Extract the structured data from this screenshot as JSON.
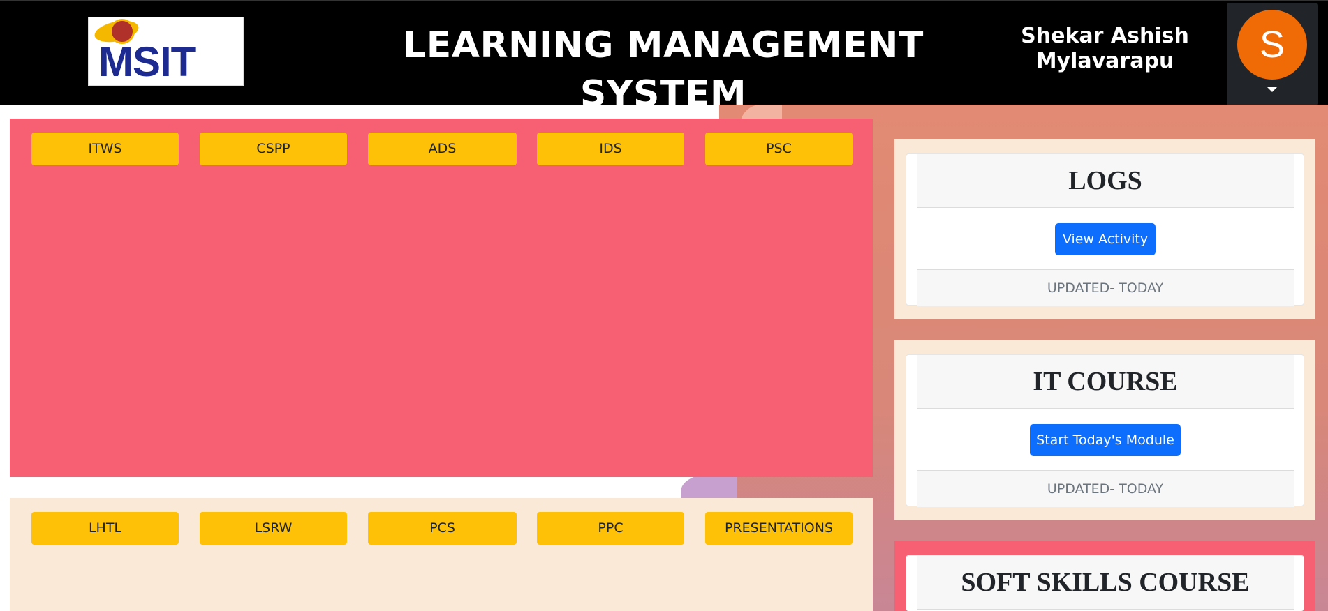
{
  "header": {
    "logo_text": "MSIT",
    "title": "LEARNING MANAGEMENT SYSTEM",
    "user_name": "Shekar Ashish Mylavarapu",
    "avatar_initial": "S"
  },
  "course_tabs_top": [
    "ITWS",
    "CSPP",
    "ADS",
    "IDS",
    "PSC"
  ],
  "course_tabs_bottom": [
    "LHTL",
    "LSRW",
    "PCS",
    "PPC",
    "PRESENTATIONS"
  ],
  "cards": {
    "logs": {
      "title": "LOGS",
      "button": "View Activity",
      "footer": "UPDATED- TODAY"
    },
    "it_course": {
      "title": "IT COURSE",
      "button": "Start Today's Module",
      "footer": "UPDATED- TODAY"
    },
    "soft_skills": {
      "title": "SOFT SKILLS COURSE"
    }
  },
  "colors": {
    "header_bg": "#000000",
    "tab_yellow": "#ffc107",
    "panel_red": "#f75f73",
    "panel_beige": "#fae9d6",
    "button_blue": "#0d6efd",
    "avatar_orange": "#f06a06"
  }
}
